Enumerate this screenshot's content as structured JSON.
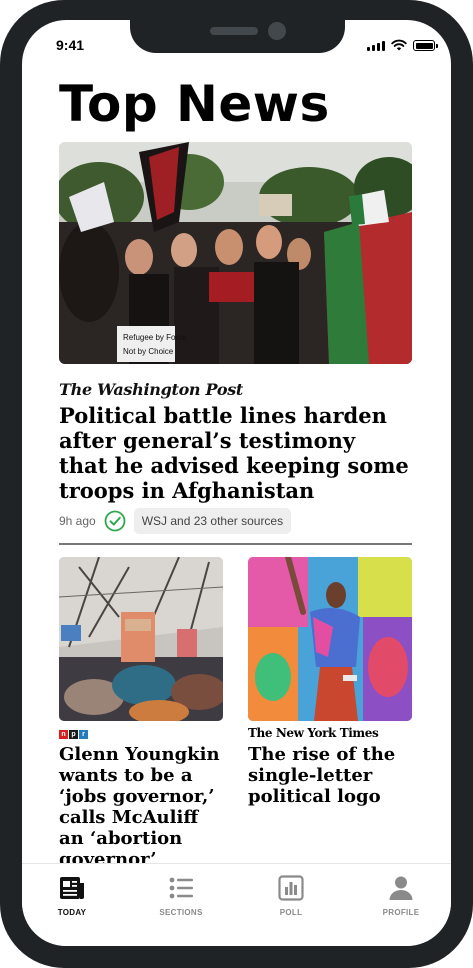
{
  "status_bar": {
    "time": "9:41"
  },
  "page": {
    "title": "Top News"
  },
  "hero_story": {
    "source": "The Washington Post",
    "headline": "Political battle lines harden after general’s testimony that he advised keeping some troops in Afghanistan",
    "time_ago": "9h ago",
    "sources_chip": "WSJ and 23 other sources",
    "image_sign_text": "Refugee by Force\nNot by Choice"
  },
  "story_left": {
    "source_logo": [
      "n",
      "p",
      "r"
    ],
    "headline": "Glenn Youngkin wants to be a ‘jobs governor,’ calls McAuliff an ‘abortion governor’"
  },
  "story_right": {
    "source": "The New York Times",
    "headline": "The rise of the single-letter political logo"
  },
  "tabs": [
    {
      "label": "TODAY",
      "icon": "newspaper-icon",
      "active": true
    },
    {
      "label": "SECTIONS",
      "icon": "list-icon",
      "active": false
    },
    {
      "label": "POLL",
      "icon": "bar-chart-icon",
      "active": false
    },
    {
      "label": "PROFILE",
      "icon": "person-icon",
      "active": false
    }
  ],
  "colors": {
    "active_tab": "#111111",
    "inactive_tab": "#8a8a8a",
    "check": "#2fa84f",
    "npr_n": "#d62021",
    "npr_p": "#1a1a1a",
    "npr_r": "#237bbd",
    "frame": "#1f2326"
  }
}
